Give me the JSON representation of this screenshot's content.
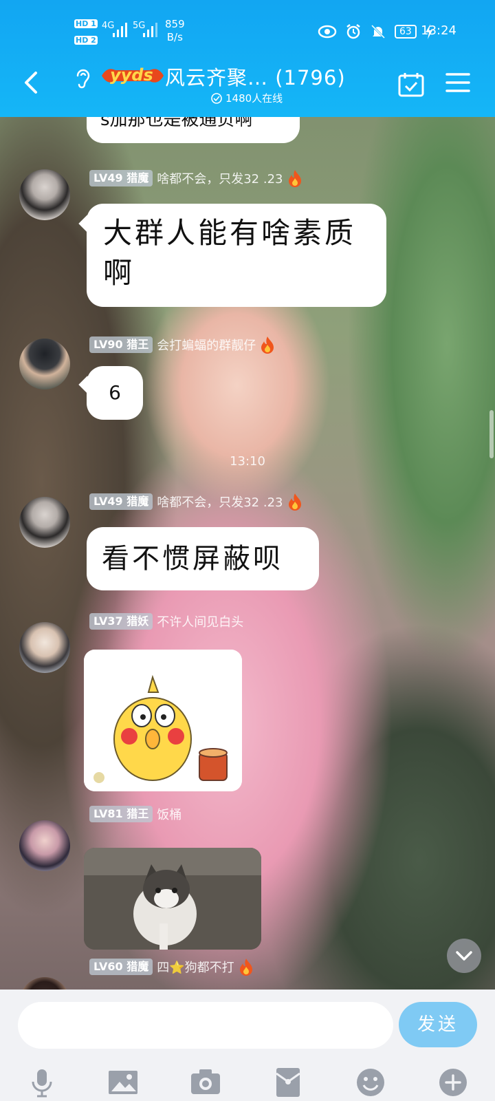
{
  "status_bar": {
    "hd1": "HD 1",
    "hd2": "HD 2",
    "net1": "4G",
    "net2": "5G",
    "speed_value": "859",
    "speed_unit": "B/s",
    "battery": "63",
    "time": "13:24"
  },
  "header": {
    "badge_text": "yyds",
    "title": "风云齐聚… (1796)",
    "online": "1480人在线"
  },
  "messages": [
    {
      "text": "s加那也是被通负啊"
    },
    {
      "level": "LV49",
      "rank": "猎魔",
      "name": "啥都不会，只发32 .23",
      "text": "大群人能有啥素质啊"
    },
    {
      "level": "LV90",
      "rank": "猎王",
      "name": "会打蝙蝠的群靓仔",
      "text": "6"
    },
    {
      "level": "LV49",
      "rank": "猎魔",
      "name": "啥都不会，只发32 .23",
      "text": "看不惯屏蔽呗"
    },
    {
      "level": "LV37",
      "rank": "猎妖",
      "name": "不许人间见白头"
    },
    {
      "level": "LV81",
      "rank": "猎王",
      "name": "饭桶"
    },
    {
      "level": "LV60",
      "rank": "猎魔",
      "name": "四⭐狗都不打"
    }
  ],
  "time_divider": "13:10",
  "input": {
    "placeholder": "",
    "send_label": "发送"
  },
  "colors": {
    "header": "#15b6f7",
    "send": "#7fcaf4",
    "fire": "#f0561c"
  }
}
